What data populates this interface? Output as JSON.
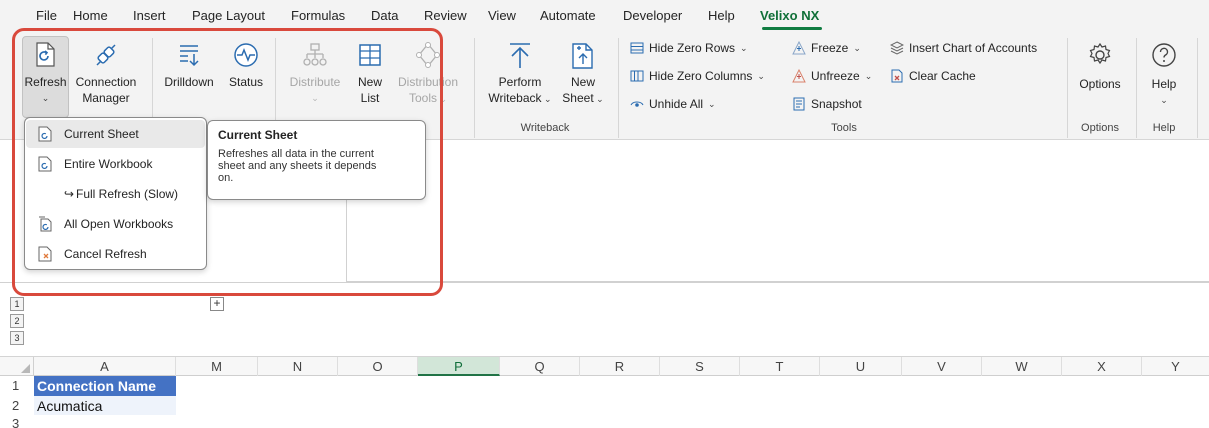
{
  "menu_tabs": [
    "File",
    "Home",
    "Insert",
    "Page Layout",
    "Formulas",
    "Data",
    "Review",
    "View",
    "Automate",
    "Developer",
    "Help",
    "Velixo NX"
  ],
  "active_tab": "Velixo NX",
  "ribbon": {
    "refresh": "Refresh",
    "connection_manager": [
      "Connection",
      "Manager"
    ],
    "drilldown": "Drilldown",
    "status": "Status",
    "distribute": "Distribute",
    "new_list": [
      "New",
      "List"
    ],
    "distribution_tools": [
      "Distribution",
      "Tools"
    ],
    "perform_writeback": [
      "Perform",
      "Writeback"
    ],
    "new_sheet": [
      "New",
      "Sheet"
    ],
    "writeback_group": "Writeback",
    "hide_zero_rows": "Hide Zero Rows",
    "hide_zero_columns": "Hide Zero Columns",
    "unhide_all": "Unhide All",
    "freeze": "Freeze",
    "unfreeze": "Unfreeze",
    "snapshot": "Snapshot",
    "insert_chart_of_accounts": "Insert Chart of Accounts",
    "clear_cache": "Clear Cache",
    "tools_group": "Tools",
    "options": "Options",
    "options_group": "Options",
    "help": "Help",
    "help_group": "Help"
  },
  "refresh_menu": {
    "items": [
      "Current Sheet",
      "Entire Workbook",
      "Full Refresh (Slow)",
      "All Open Workbooks",
      "Cancel Refresh"
    ]
  },
  "tooltip": {
    "title": "Current Sheet",
    "body": [
      "Refreshes all data in the current",
      "sheet and any sheets it depends",
      "on."
    ]
  },
  "outline_levels": [
    "1",
    "2",
    "3"
  ],
  "expand_symbol": "+",
  "columns": [
    "A",
    "M",
    "N",
    "O",
    "P",
    "Q",
    "R",
    "S",
    "T",
    "U",
    "V",
    "W",
    "X",
    "Y"
  ],
  "selected_column": "P",
  "rows": [
    "1",
    "2",
    "3"
  ],
  "cells": {
    "a1": "Connection Name",
    "a2": "Acumatica"
  },
  "colors": {
    "active_tab": "#0f6f37",
    "header_fill": "#4472c4",
    "highlight": "#d9493c",
    "icon_blue": "#2b6cb0"
  }
}
